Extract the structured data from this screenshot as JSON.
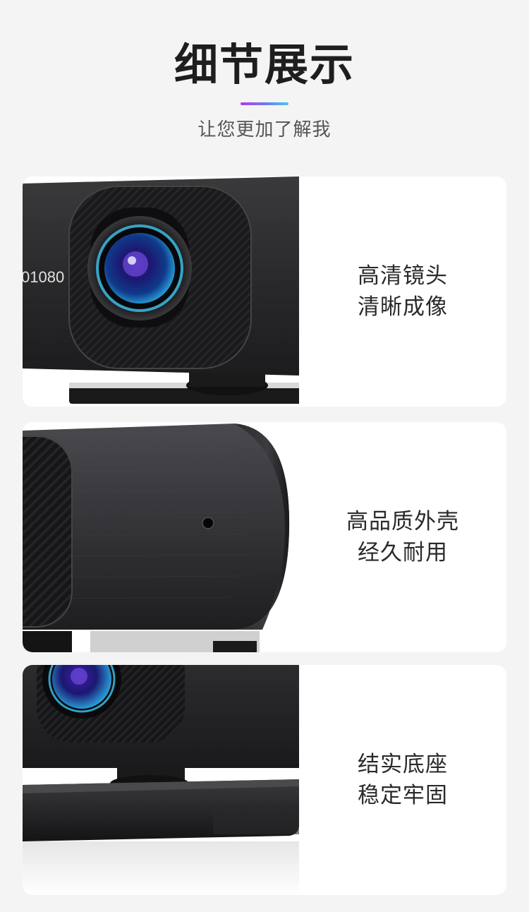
{
  "header": {
    "title": "细节展示",
    "subtitle": "让您更加了解我"
  },
  "features": [
    {
      "line1": "高清镜头",
      "line2": "清晰成像",
      "printed_label": "01080"
    },
    {
      "line1": "高品质外壳",
      "line2": "经久耐用"
    },
    {
      "line1": "结实底座",
      "line2": "稳定牢固"
    }
  ]
}
